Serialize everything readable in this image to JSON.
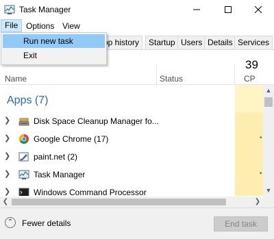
{
  "window": {
    "title": "Task Manager",
    "controls": {
      "minimize": "—",
      "maximize": "☐",
      "close": "✕"
    }
  },
  "menubar": {
    "file": "File",
    "options": "Options",
    "view": "View"
  },
  "file_menu": {
    "run_new_task": "Run new task",
    "exit": "Exit"
  },
  "tabs": [
    "pp history",
    "Startup",
    "Users",
    "Details",
    "Services"
  ],
  "columns": {
    "name": "Name",
    "status": "Status",
    "cpu_percent": "39",
    "cpu_label": "CP"
  },
  "groups": {
    "apps": "Apps (7)"
  },
  "rows": [
    {
      "label": "Disk Space Cleanup Manager fo...",
      "icon": "disk-cleanup-icon"
    },
    {
      "label": "Google Chrome (17)",
      "icon": "chrome-icon"
    },
    {
      "label": "paint.net (2)",
      "icon": "paintnet-icon"
    },
    {
      "label": "Task Manager",
      "icon": "task-manager-icon"
    },
    {
      "label": "Windows Command Processor",
      "icon": "cmd-icon"
    }
  ],
  "footer": {
    "fewer_details": "Fewer details",
    "end_task": "End task"
  },
  "colors": {
    "accent_blue": "#1f6bbf",
    "menu_highlight": "#91c9f7",
    "cpu_column": "#fff4c4"
  }
}
